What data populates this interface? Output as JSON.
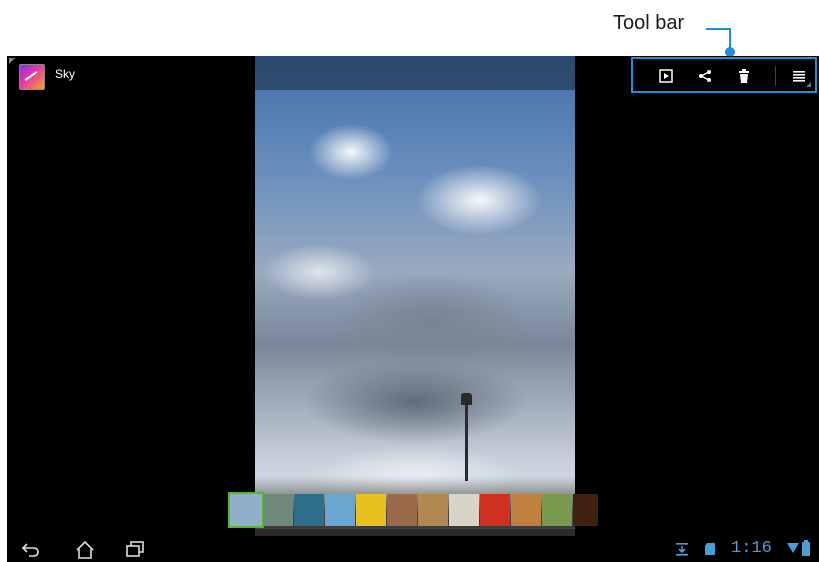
{
  "callout": {
    "label": "Tool bar"
  },
  "app": {
    "title": "Sky"
  },
  "toolbar": {
    "items": [
      "slideshow-icon",
      "share-icon",
      "delete-icon",
      "menu-icon"
    ]
  },
  "filmstrip": {
    "thumbnails": [
      {
        "color": "#8fb0c8",
        "selected": true
      },
      {
        "color": "#6f8a7a"
      },
      {
        "color": "#2f6e8a"
      },
      {
        "color": "#6aa6cf"
      },
      {
        "color": "#e8c020"
      },
      {
        "color": "#9a6a4a"
      },
      {
        "color": "#b08850"
      },
      {
        "color": "#d8d4c8"
      },
      {
        "color": "#d03020"
      },
      {
        "color": "#c08040"
      },
      {
        "color": "#7a9a50"
      },
      {
        "color": "#402010"
      }
    ]
  },
  "statusbar": {
    "time": "1:16"
  },
  "colors": {
    "accent": "#1e8fd8",
    "selection": "#5bb52b",
    "status": "#4a9ed8"
  }
}
